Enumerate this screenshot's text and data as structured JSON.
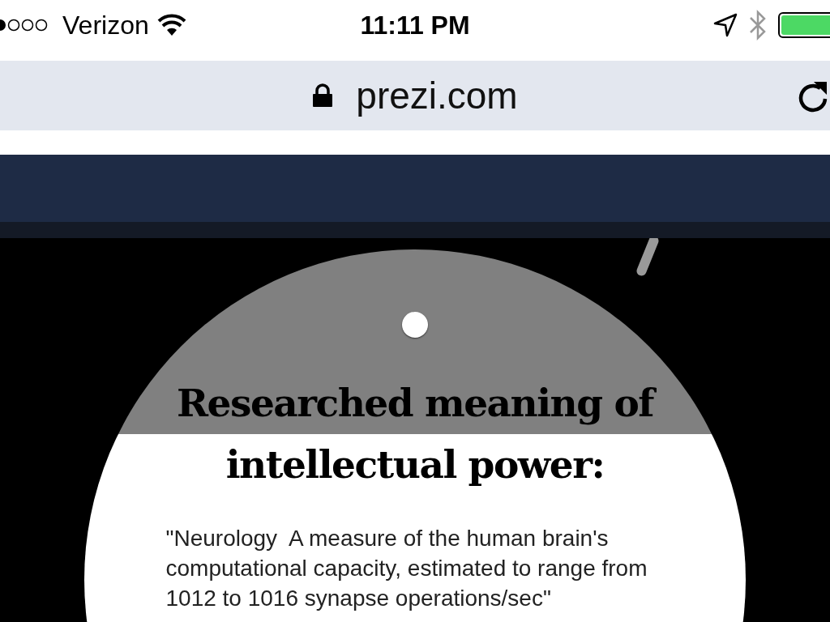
{
  "status_bar": {
    "carrier": "Verizon",
    "time": "11:11 PM"
  },
  "address_bar": {
    "url": "prezi.com"
  },
  "slide": {
    "title": "Researched meaning of intellectual power:",
    "quote": "\"Neurology  A measure of the human brain's computational capacity, estimated to range from 1012 to 1016 synapse operations/sec\""
  }
}
